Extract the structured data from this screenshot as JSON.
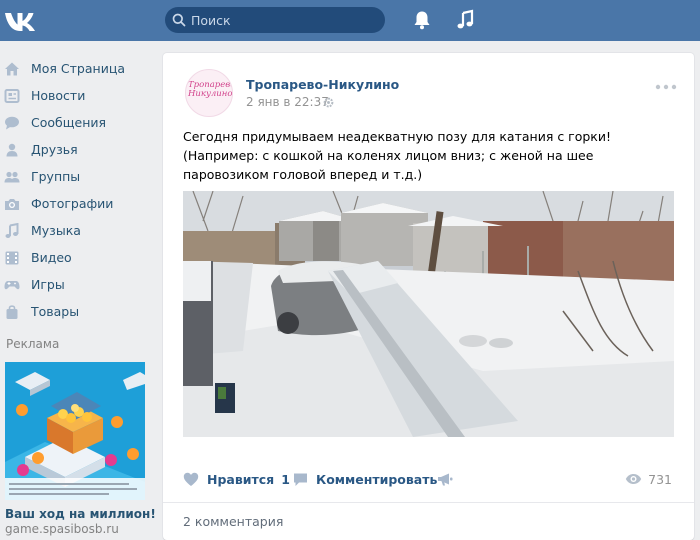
{
  "header": {
    "logo_icon": "vk-logo-icon",
    "search_placeholder": "Поиск",
    "icons": [
      "bell-icon",
      "music-note-icon"
    ],
    "colors": {
      "bar": "#4a76a8",
      "search_bg": "#224b7a"
    }
  },
  "sidebar": {
    "items": [
      {
        "label": "Моя Страница",
        "icon": "home-icon"
      },
      {
        "label": "Новости",
        "icon": "news-icon"
      },
      {
        "label": "Сообщения",
        "icon": "messages-icon"
      },
      {
        "label": "Друзья",
        "icon": "friend-icon"
      },
      {
        "label": "Группы",
        "icon": "groups-icon"
      },
      {
        "label": "Фотографии",
        "icon": "camera-icon"
      },
      {
        "label": "Музыка",
        "icon": "music-icon"
      },
      {
        "label": "Видео",
        "icon": "video-icon"
      },
      {
        "label": "Игры",
        "icon": "gamepad-icon"
      },
      {
        "label": "Товары",
        "icon": "shopping-bag-icon"
      }
    ],
    "ads": {
      "title": "Реклама",
      "ad_title": "Ваш ход на миллион!",
      "ad_domain": "game.spasibosb.ru"
    }
  },
  "post": {
    "author": "Тропарево-Никулино",
    "avatar_text": "Тропарево Никулино",
    "date": "2 янв в 22:37",
    "text": "Сегодня придумываем неадекватную позу для катания с горки! (Например: с кошкой на коленях лицом вниз; с женой на шее паровозиком головой вперед и т.д.)",
    "actions": {
      "like_label": "Нравится",
      "like_count": "1",
      "comment_label": "Комментировать",
      "views_count": "731"
    },
    "comments_count_label": "2 комментария"
  }
}
